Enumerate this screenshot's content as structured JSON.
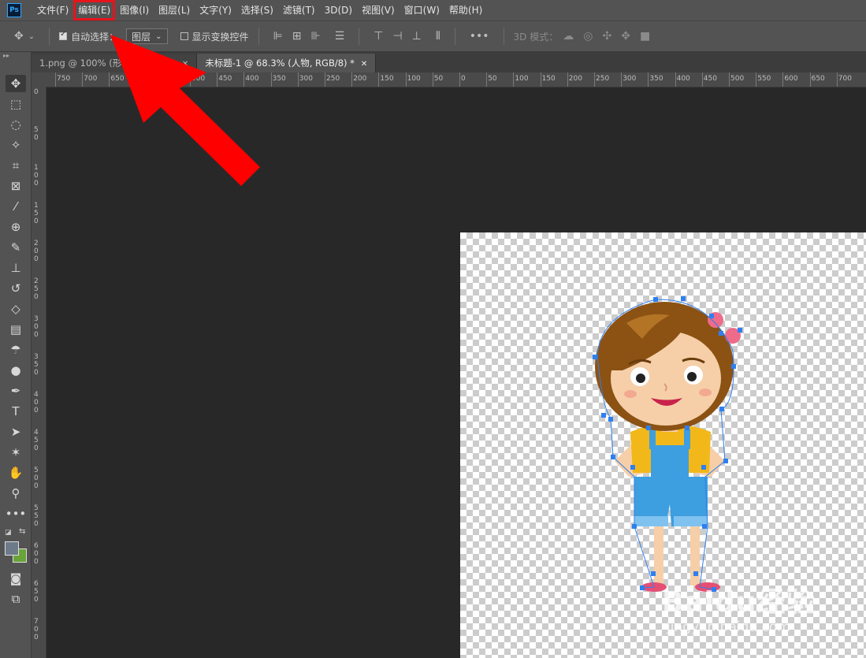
{
  "menubar": {
    "logo": "Ps",
    "items": [
      "文件(F)",
      "编辑(E)",
      "图像(I)",
      "图层(L)",
      "文字(Y)",
      "选择(S)",
      "滤镜(T)",
      "3D(D)",
      "视图(V)",
      "窗口(W)",
      "帮助(H)"
    ],
    "highlighted": "编辑(E)"
  },
  "optionsbar": {
    "auto_select_label": "自动选择：",
    "auto_select_checked": true,
    "target_value": "图层",
    "show_transform_label": "显示变换控件",
    "mode_3d_label": "3D 模式："
  },
  "tabs": [
    {
      "label": "1.png @ 100% (形状, RGB/8) *",
      "active": false
    },
    {
      "label": "未标题-1 @ 68.3% (人物, RGB/8) *",
      "active": true
    }
  ],
  "ruler_h": [
    "750",
    "700",
    "650",
    "600",
    "550",
    "500",
    "450",
    "400",
    "350",
    "300",
    "250",
    "200",
    "150",
    "100",
    "50",
    "0",
    "50",
    "100",
    "150",
    "200",
    "250",
    "300",
    "350",
    "400",
    "450",
    "500",
    "550",
    "600",
    "650",
    "700"
  ],
  "ruler_v": [
    "0",
    "50",
    "100",
    "150",
    "200",
    "250",
    "300",
    "350",
    "400",
    "450",
    "500",
    "550",
    "600",
    "650",
    "700"
  ],
  "watermark": {
    "main": "Baidu经验",
    "sub": "jingyan.baidu.com"
  },
  "colors": {
    "highlight": "#e8141b",
    "arrow": "#ff0000",
    "foreground": "#6c7a8a",
    "background": "#6aa33a"
  }
}
